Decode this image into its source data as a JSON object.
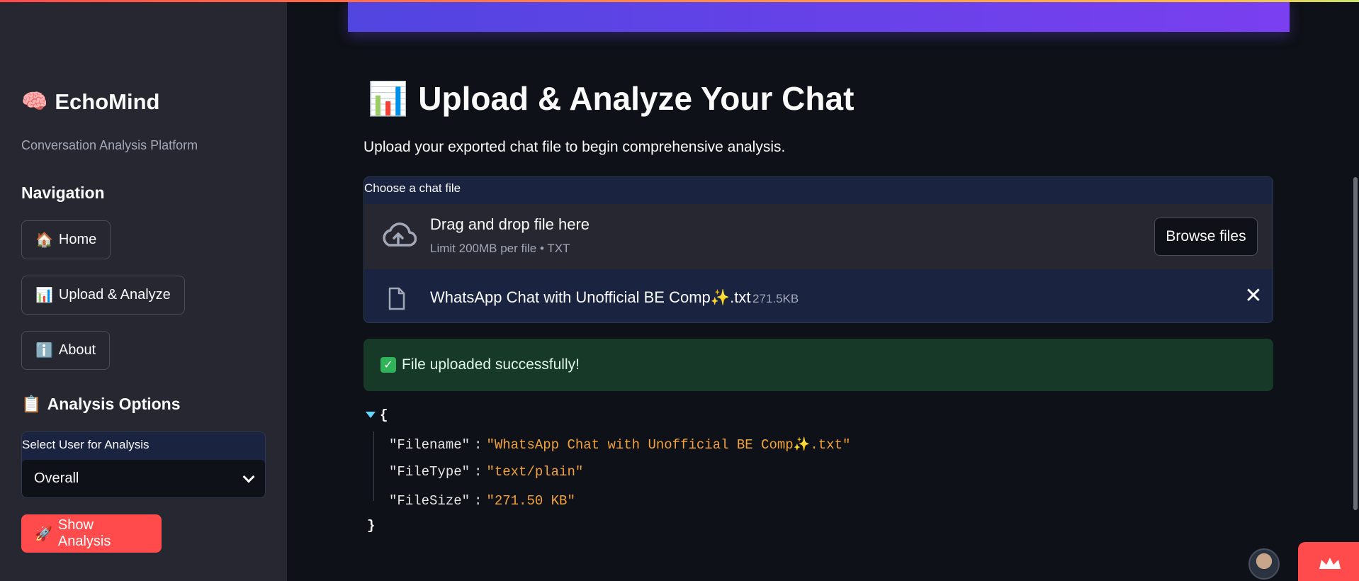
{
  "sidebar": {
    "brand_icon": "🧠",
    "brand_title": "EchoMind",
    "brand_subtitle": "Conversation Analysis Platform",
    "nav_heading": "Navigation",
    "nav_items": [
      {
        "icon": "🏠",
        "label": "Home"
      },
      {
        "icon": "📊",
        "label": "Upload & Analyze"
      },
      {
        "icon": "ℹ️",
        "label": "About"
      }
    ],
    "options_icon": "📋",
    "options_heading": "Analysis Options",
    "select_label": "Select User for Analysis",
    "select_value": "Overall",
    "action_icon": "🚀",
    "action_label": "Show Analysis"
  },
  "main": {
    "title_icon": "📊",
    "title": "Upload & Analyze Your Chat",
    "intro": "Upload your exported chat file to begin comprehensive analysis.",
    "uploader": {
      "label": "Choose a chat file",
      "drop_title": "Drag and drop file here",
      "drop_subtitle": "Limit 200MB per file • TXT",
      "browse_label": "Browse files",
      "file_name": "WhatsApp Chat with Unofficial BE Comp✨.txt",
      "file_size": "271.5KB",
      "close_glyph": "✕"
    },
    "success_message": "File uploaded successfully!",
    "json_view": {
      "open": "{",
      "close": "}",
      "sep": ":",
      "entries": [
        {
          "key": "\"Filename\"",
          "value": "\"WhatsApp Chat with Unofficial BE Comp✨.txt\""
        },
        {
          "key": "\"FileType\"",
          "value": "\"text/plain\""
        },
        {
          "key": "\"FileSize\"",
          "value": "\"271.50 KB\""
        }
      ]
    }
  },
  "colors": {
    "primary": "#ff4b4b",
    "sidebar_bg": "#262730",
    "main_bg": "#0e1117",
    "success_bg": "#173928",
    "json_value": "#f2a23b",
    "banner_start": "#5145e0",
    "banner_end": "#7a3ff0"
  }
}
